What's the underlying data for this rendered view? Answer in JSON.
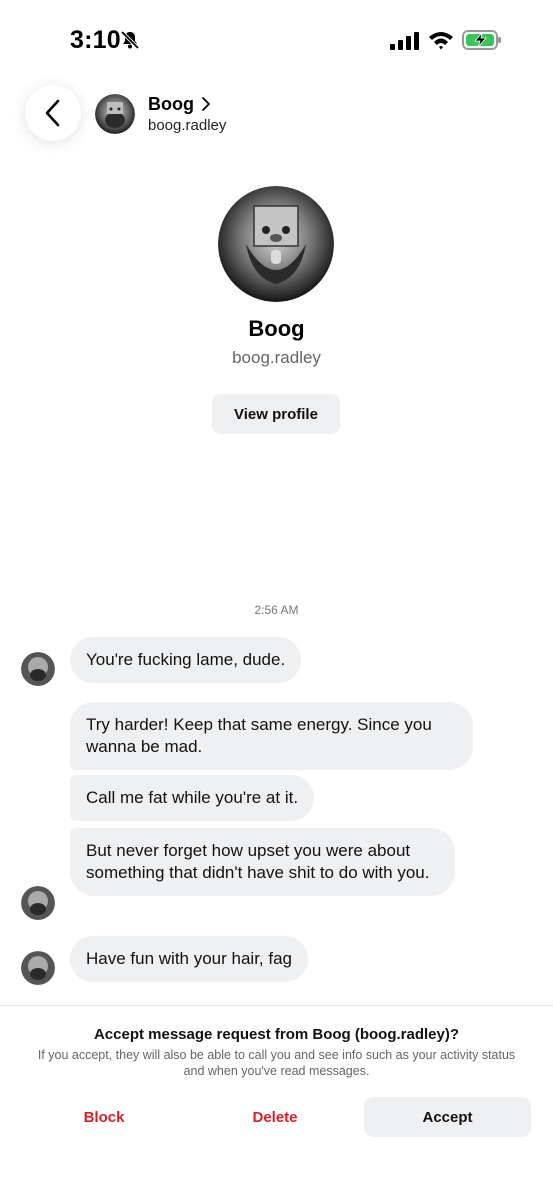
{
  "status_bar": {
    "time": "3:10"
  },
  "header": {
    "name": "Boog",
    "username": "boog.radley"
  },
  "profile": {
    "name": "Boog",
    "username": "boog.radley",
    "view_profile_label": "View profile"
  },
  "conversation": {
    "timestamp": "2:56 AM",
    "messages": [
      "You're fucking lame, dude.",
      "Try harder! Keep that same energy. Since you wanna be mad.",
      "Call me fat while you're at it.",
      "But never forget how upset you were about something that didn't have shit to do with you.",
      "Have fun with your hair, fag"
    ]
  },
  "request": {
    "title": "Accept message request from Boog (boog.radley)?",
    "description": "If you accept, they will also be able to call you and see info such as your activity status and when you've read messages.",
    "block_label": "Block",
    "delete_label": "Delete",
    "accept_label": "Accept"
  },
  "colors": {
    "danger": "#d81f26",
    "bubble": "#eff0f2",
    "battery": "#34c759"
  }
}
